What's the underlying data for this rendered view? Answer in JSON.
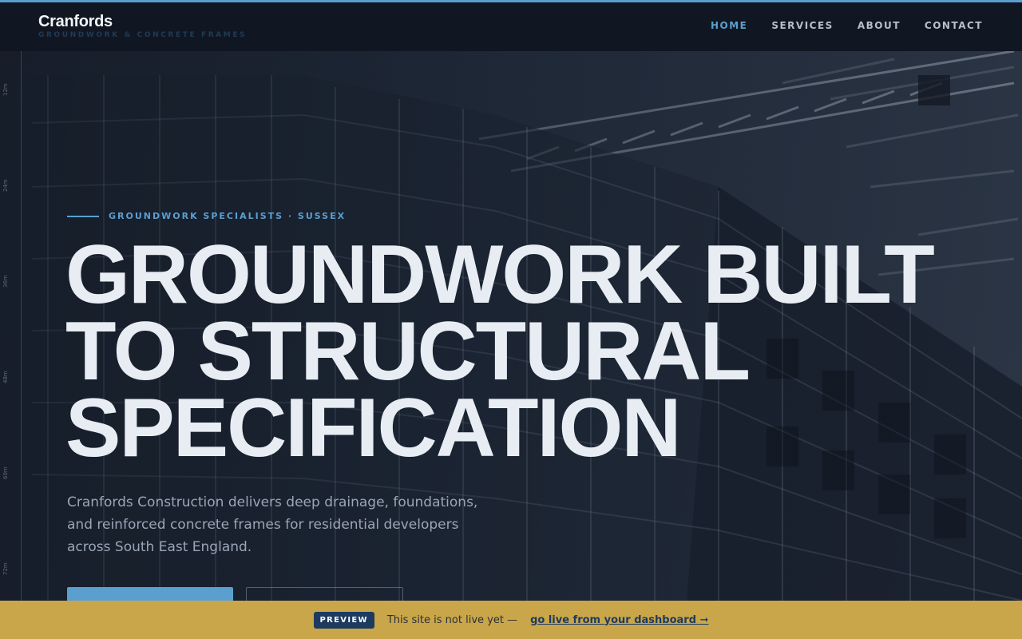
{
  "brand": {
    "name": "Cranfords",
    "tagline": "GROUNDWORK & CONCRETE FRAMES"
  },
  "nav": {
    "items": [
      {
        "label": "HOME",
        "active": true
      },
      {
        "label": "SERVICES",
        "active": false
      },
      {
        "label": "ABOUT",
        "active": false
      },
      {
        "label": "CONTACT",
        "active": false
      }
    ]
  },
  "ruler": {
    "labels": [
      "12m",
      "24m",
      "36m",
      "48m",
      "60m",
      "72m"
    ]
  },
  "hero": {
    "eyebrow": "GROUNDWORK SPECIALISTS · SUSSEX",
    "title_lines": [
      "GROUNDWORK BUILT",
      "TO STRUCTURAL",
      "SPECIFICATION"
    ],
    "lead": "Cranfords Construction delivers deep drainage, foundations, and reinforced concrete frames for residential developers across South East England."
  },
  "banner": {
    "badge": "PREVIEW",
    "text": "This site is not live yet —",
    "link": "go live from your dashboard ➞"
  },
  "colors": {
    "accent": "#5a9fd0",
    "background": "#111722",
    "banner": "#c9a649",
    "badge": "#1e3a5f"
  }
}
